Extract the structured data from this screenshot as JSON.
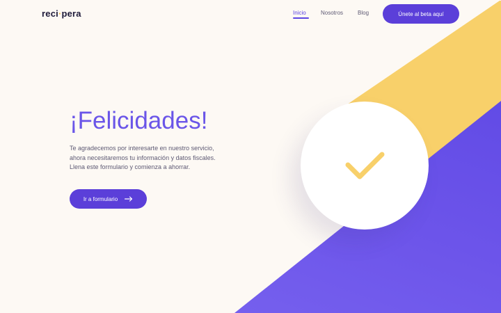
{
  "nav": {
    "logo_prefix": "reci",
    "logo_dot": "·",
    "logo_suffix": "pera",
    "links": [
      {
        "label": "Inicio",
        "active": true
      },
      {
        "label": "Nosotros",
        "active": false
      },
      {
        "label": "Blog",
        "active": false
      }
    ],
    "cta_label": "Únete al beta aquí"
  },
  "hero": {
    "title": "¡Felicidades!",
    "description_lines": [
      "Te agradecemos por interesarte en nuestro servicio,",
      "ahora necesitaremos tu información y datos fiscales.",
      "Llena este formulario y comienza a ahorrar."
    ],
    "button_label": "Ir a formulario",
    "button_icon": "arrow-right-icon"
  },
  "illustration": {
    "icon": "checkmark-icon"
  },
  "colors": {
    "accent_purple": "#5b3fd9",
    "title_purple": "#6a55e8",
    "yellow": "#f8d06a",
    "background": "#fdf9f4"
  }
}
